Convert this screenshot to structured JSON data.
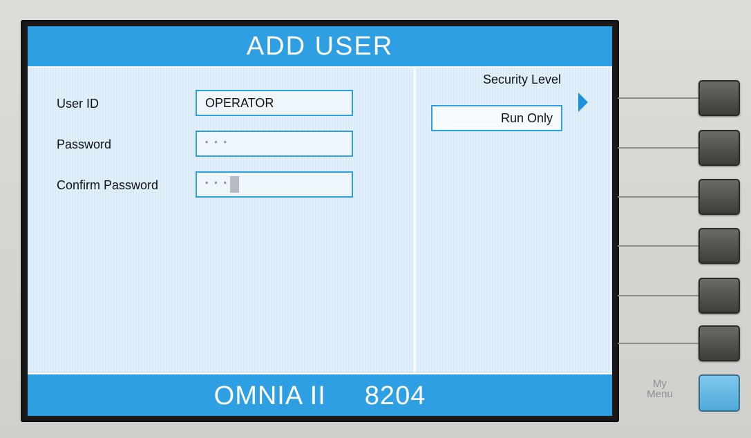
{
  "header": {
    "title": "ADD USER"
  },
  "form": {
    "user_id_label": "User ID",
    "user_id_value": "OPERATOR",
    "password_label": "Password",
    "password_value": "* * *",
    "confirm_label": "Confirm Password",
    "confirm_value": "* * *"
  },
  "security": {
    "label": "Security Level",
    "value": "Run Only"
  },
  "footer": {
    "brand": "OMNIA II",
    "model": "8204"
  },
  "panel": {
    "my_menu_line1": "My",
    "my_menu_line2": "Menu"
  },
  "colors": {
    "accent": "#2f9fe3",
    "screen_bg": "#d9ecf8",
    "my_menu_button": "#5fb6e2"
  },
  "icons": {
    "security_arrow": "triangle-right-icon"
  }
}
